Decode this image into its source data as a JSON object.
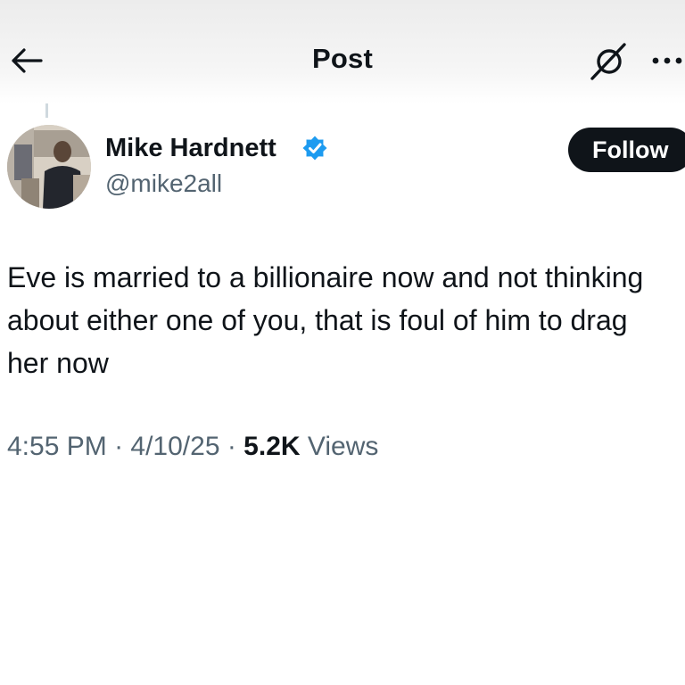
{
  "header": {
    "title": "Post",
    "back_icon": "arrow-left-icon",
    "grok_icon": "grok-icon",
    "more_icon": "more-horizontal-icon"
  },
  "author": {
    "display_name": "Mike Hardnett",
    "handle": "@mike2all",
    "verified": true,
    "verified_color": "#1d9bf0"
  },
  "follow_button": {
    "label": "Follow"
  },
  "post": {
    "text": "Eve is married to a billionaire now and not thinking about either one of you, that is foul of him to drag her now",
    "time": "4:55 PM",
    "separator": " · ",
    "date": "4/10/25",
    "views_count": "5.2K",
    "views_label": " Views"
  }
}
